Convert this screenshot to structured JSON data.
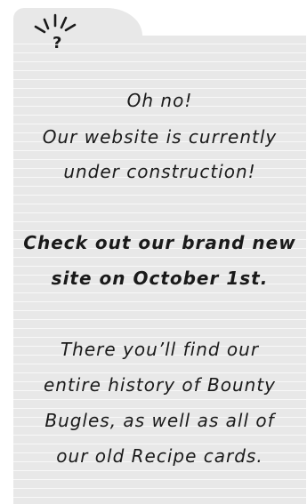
{
  "tab": {
    "icon": "question-burst-icon"
  },
  "message": {
    "intro": [
      "Oh no!",
      "Our website is currently",
      "under construction!"
    ],
    "cta": [
      "Check out our brand new",
      "site on October 1st."
    ],
    "details": [
      "There you’ll find our",
      "entire history of Bounty",
      "Bugles, as well as all of",
      "our old Recipe cards."
    ]
  },
  "colors": {
    "card": "#e8e8e8",
    "lines": "#f8f8f8",
    "text": "#1a1a1a"
  }
}
